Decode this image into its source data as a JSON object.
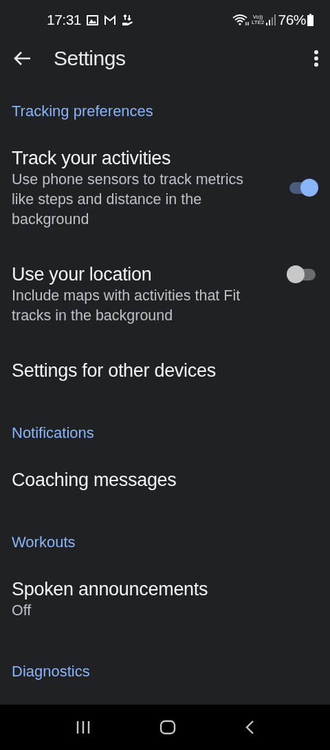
{
  "status_bar": {
    "time": "17:31",
    "volte_top": "Vo))",
    "volte_bottom": "LTE2",
    "battery": "76%"
  },
  "toolbar": {
    "title": "Settings"
  },
  "sections": [
    {
      "header": "Tracking preferences",
      "items": [
        {
          "kind": "switch",
          "title": "Track your activities",
          "subtitle": "Use phone sensors to track metrics like steps and distance in the background",
          "on": true
        },
        {
          "kind": "switch",
          "title": "Use your location",
          "subtitle": "Include maps with activities that Fit tracks in the background",
          "on": false
        },
        {
          "kind": "plain",
          "title": "Settings for other devices"
        }
      ]
    },
    {
      "header": "Notifications",
      "items": [
        {
          "kind": "plain",
          "title": "Coaching messages"
        }
      ]
    },
    {
      "header": "Workouts",
      "items": [
        {
          "kind": "plain",
          "title": "Spoken announcements",
          "subtitle": "Off"
        }
      ]
    },
    {
      "header": "Diagnostics"
    }
  ]
}
